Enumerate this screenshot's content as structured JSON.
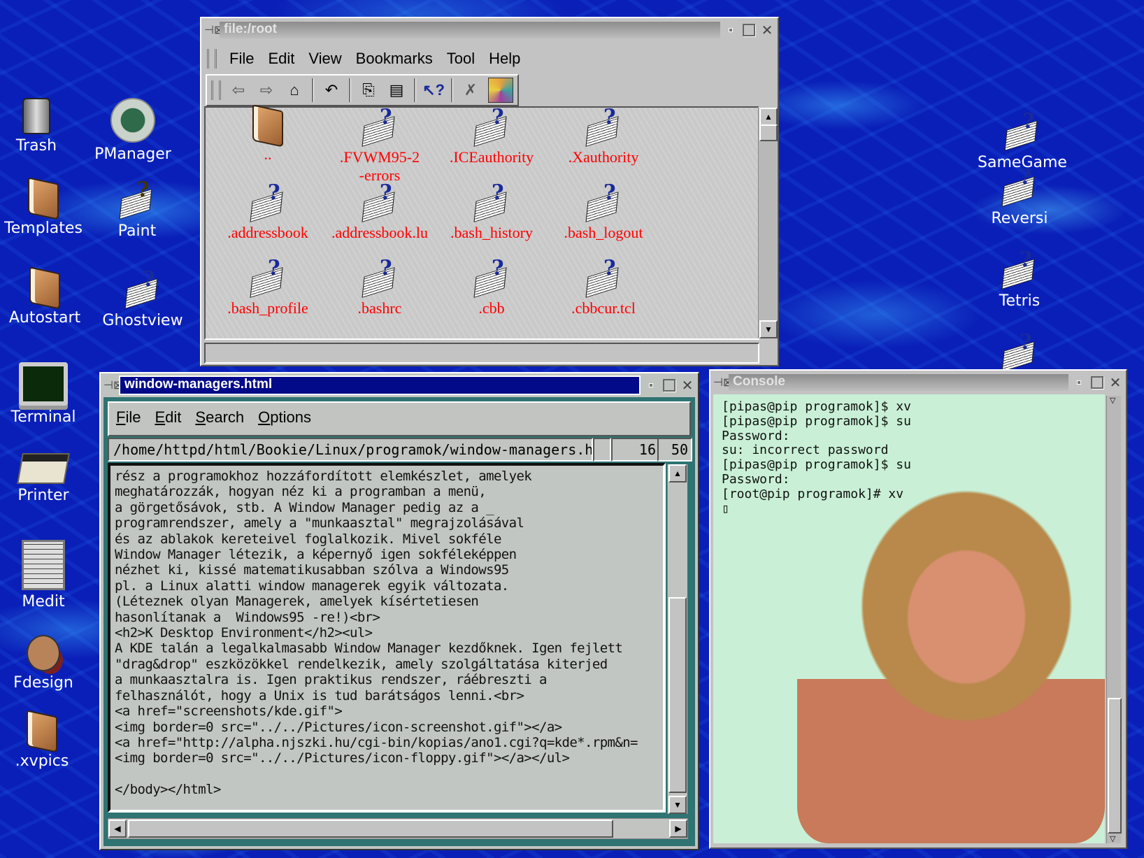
{
  "desktop": {
    "left_icons": [
      {
        "label": "Trash",
        "icon": "trash-icon"
      },
      {
        "label": "PManager",
        "icon": "recycle-icon"
      },
      {
        "label": "Templates",
        "icon": "folder-icon"
      },
      {
        "label": "Paint",
        "icon": "paint-icon"
      },
      {
        "label": "Autostart",
        "icon": "folder-icon"
      },
      {
        "label": "Ghostview",
        "icon": "document-icon"
      },
      {
        "label": "Terminal",
        "icon": "terminal-icon"
      },
      {
        "label": "Printer",
        "icon": "printer-icon"
      },
      {
        "label": "Medit",
        "icon": "editor-icon"
      },
      {
        "label": "Fdesign",
        "icon": "fdesign-icon"
      },
      {
        "label": ".xvpics",
        "icon": "folder-icon"
      }
    ],
    "right_icons": [
      {
        "label": "SameGame",
        "icon": "document-icon"
      },
      {
        "label": "Reversi",
        "icon": "document-icon"
      },
      {
        "label": "Tetris",
        "icon": "document-icon"
      },
      {
        "label": "",
        "icon": "document-icon"
      }
    ]
  },
  "file_manager": {
    "title": "file:/root",
    "menu": [
      "File",
      "Edit",
      "View",
      "Bookmarks",
      "Tool",
      "Help"
    ],
    "toolbar": [
      {
        "name": "back-icon",
        "glyph": "⇦"
      },
      {
        "name": "forward-icon",
        "glyph": "⇨"
      },
      {
        "name": "home-icon",
        "glyph": "⌂"
      },
      {
        "name": "reload-icon",
        "glyph": "↶"
      },
      {
        "name": "copy-icon",
        "glyph": "⎘"
      },
      {
        "name": "paste-icon",
        "glyph": "📋"
      },
      {
        "name": "help-icon",
        "glyph": "?"
      },
      {
        "name": "stop-icon",
        "glyph": "✗"
      }
    ],
    "files": [
      {
        "name": "..",
        "type": "folder"
      },
      {
        "name": ".FVWM95-2\n-errors",
        "type": "file"
      },
      {
        "name": ".ICEauthority",
        "type": "file"
      },
      {
        "name": ".Xauthority",
        "type": "file"
      },
      {
        "name": ".addressbook",
        "type": "file"
      },
      {
        "name": ".addressbook.lu",
        "type": "file"
      },
      {
        "name": ".bash_history",
        "type": "file"
      },
      {
        "name": ".bash_logout",
        "type": "file"
      },
      {
        "name": ".bash_profile",
        "type": "file"
      },
      {
        "name": ".bashrc",
        "type": "file"
      },
      {
        "name": ".cbb",
        "type": "file"
      },
      {
        "name": ".cbbcur.tcl",
        "type": "file"
      }
    ],
    "status": ""
  },
  "editor": {
    "title": "window-managers.html",
    "menu": [
      {
        "label": "File",
        "mnemonic": "F",
        "rest": "ile"
      },
      {
        "label": "Edit",
        "mnemonic": "E",
        "rest": "dit"
      },
      {
        "label": "Search",
        "mnemonic": "S",
        "rest": "earch"
      },
      {
        "label": "Options",
        "mnemonic": "O",
        "rest": "ptions"
      }
    ],
    "path": "/home/httpd/html/Bookie/Linux/programok/window-managers.html",
    "line": "16",
    "column": "50",
    "content": "rész a programokhoz hozzáfordított elemkészlet, amelyek\nmeghatározzák, hogyan néz ki a programban a menü,\na görgetősávok, stb. A Window Manager pedig az a _\nprogramrendszer, amely a \"munkaasztal\" megrajzolásával\nés az ablakok kereteivel foglalkozik. Mivel sokféle\nWindow Manager létezik, a képernyő igen sokféleképpen\nnézhet ki, kissé matematikusabban szólva a Windows95\npl. a Linux alatti window managerek egyik változata.\n(Léteznek olyan Managerek, amelyek kísértetiesen\nhasonlítanak a  Windows95 -re!)<br>\n<h2>K Desktop Environment</h2><ul>\nA KDE talán a legalkalmasabb Window Manager kezdőknek. Igen fejlett\n\"drag&drop\" eszközökkel rendelkezik, amely szolgáltatása kiterjed\na munkaasztalra is. Igen praktikus rendszer, ráébreszti a\nfelhasználót, hogy a Unix is tud barátságos lenni.<br>\n<a href=\"screenshots/kde.gif\">\n<img border=0 src=\"../../Pictures/icon-screenshot.gif\"></a>\n<a href=\"http://alpha.njszki.hu/cgi-bin/kopias/ano1.cgi?q=kde*.rpm&n=\n<img border=0 src=\"../../Pictures/icon-floppy.gif\"></a></ul>\n\n</body></html>"
  },
  "console": {
    "title": "Console",
    "lines": "[pipas@pip programok]$ xv\n[pipas@pip programok]$ su\nPassword:\nsu: incorrect password\n[pipas@pip programok]$ su\nPassword:\n[root@pip programok]# xv\n▯"
  },
  "colors": {
    "desktop_bg": "#0a1fb8",
    "active_title": "#020a8a",
    "file_label": "#ff0000",
    "console_bg": "#c9f0d6"
  }
}
